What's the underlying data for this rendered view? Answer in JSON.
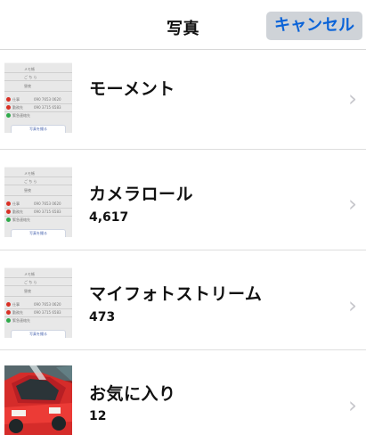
{
  "header": {
    "title": "写真",
    "cancel_label": "キャンセル"
  },
  "albums": [
    {
      "title": "モーメント",
      "count": "",
      "thumbnail_type": "document-screenshot",
      "thumbnail": {
        "lines": [
          "メモ帳",
          "ご ち ら",
          "昼夜",
          "仕事",
          "自宅",
          "勤務先",
          "緊急連絡先",
          "写真を撮る"
        ],
        "numbers": [
          "090 7653 0620",
          "090 3715 6583"
        ]
      }
    },
    {
      "title": "カメラロール",
      "count": "4,617",
      "thumbnail_type": "document-screenshot",
      "thumbnail": {
        "lines": [
          "メモ帳",
          "ご ち ら",
          "昼夜",
          "仕事",
          "自宅",
          "勤務先",
          "緊急連絡先",
          "写真を撮る"
        ],
        "numbers": [
          "090 7653 0620",
          "090 3715 6583"
        ]
      }
    },
    {
      "title": "マイフォトストリーム",
      "count": "473",
      "thumbnail_type": "document-screenshot",
      "thumbnail": {
        "lines": [
          "メモ帳",
          "ご ち ら",
          "昼夜",
          "仕事",
          "自宅",
          "勤務先",
          "緊急連絡先",
          "写真を撮る"
        ],
        "numbers": [
          "090 7653 0620",
          "090 3715 6583"
        ]
      }
    },
    {
      "title": "お気に入り",
      "count": "12",
      "thumbnail_type": "car-photo",
      "thumbnail": {
        "lines": [],
        "numbers": []
      }
    }
  ],
  "colors": {
    "accent": "#0a63d8",
    "cancel_background": "#cfd3d8",
    "chevron": "#c7c7cc",
    "divider": "#dedede"
  },
  "icons": {
    "chevron": "chevron-right-icon"
  }
}
